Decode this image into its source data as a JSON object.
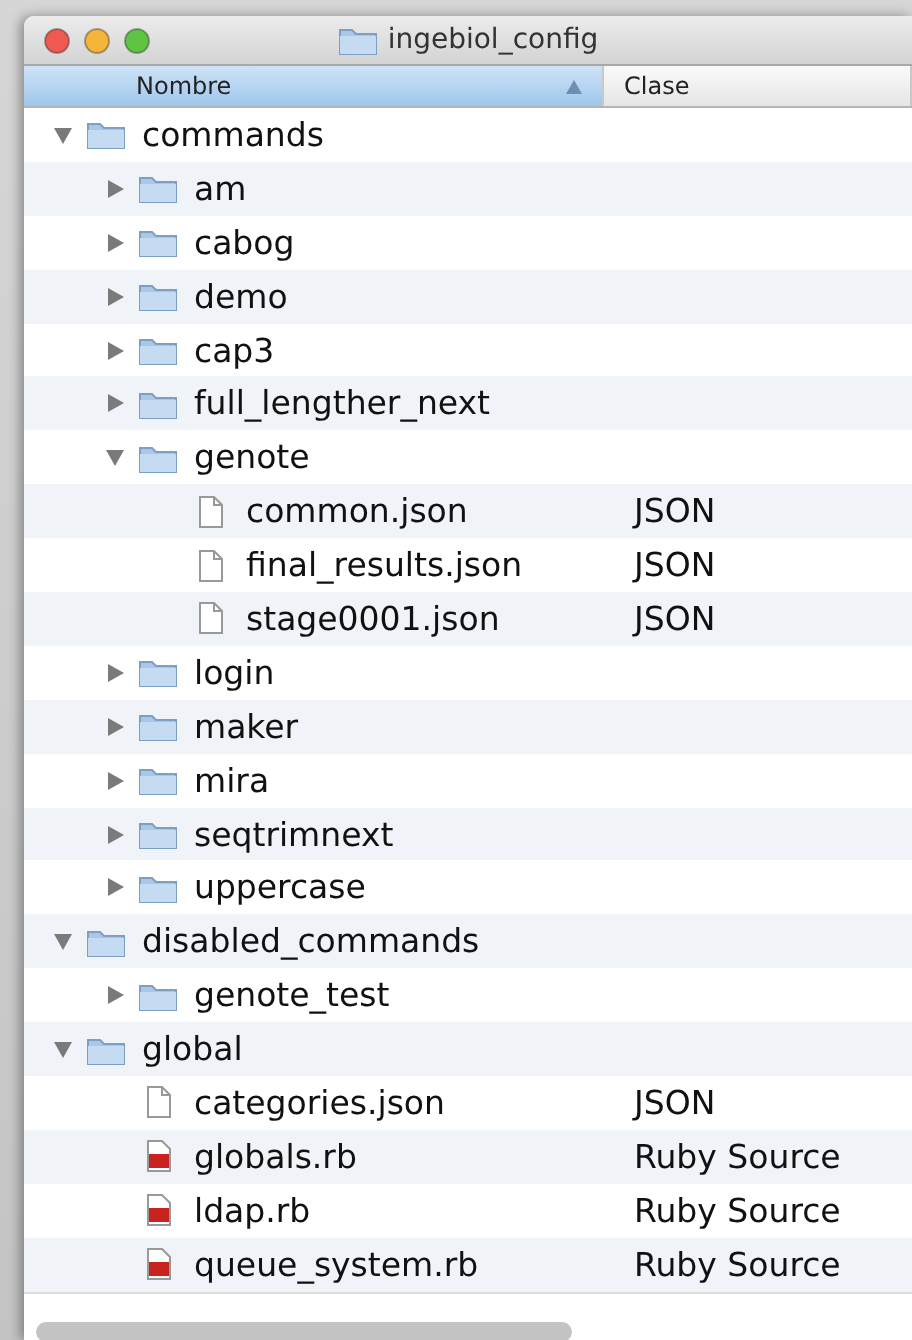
{
  "window": {
    "title": "ingebiol_config"
  },
  "columns": [
    {
      "label": "Nombre",
      "selected": true
    },
    {
      "label": "Clase",
      "selected": false
    }
  ],
  "items": [
    {
      "kind": "folder",
      "name": "commands",
      "expanded": true,
      "children": [
        {
          "kind": "folder",
          "name": "am",
          "expanded": false
        },
        {
          "kind": "folder",
          "name": "cabog",
          "expanded": false
        },
        {
          "kind": "folder",
          "name": "demo",
          "expanded": false
        },
        {
          "kind": "folder",
          "name": "cap3",
          "expanded": false
        },
        {
          "kind": "folder",
          "name": "full_lengther_next",
          "expanded": false
        },
        {
          "kind": "folder",
          "name": "genote",
          "expanded": true,
          "children": [
            {
              "kind": "file",
              "name": "common.json",
              "class": "JSON"
            },
            {
              "kind": "file",
              "name": "final_results.json",
              "class": "JSON"
            },
            {
              "kind": "file",
              "name": "stage0001.json",
              "class": "JSON"
            }
          ]
        },
        {
          "kind": "folder",
          "name": "login",
          "expanded": false
        },
        {
          "kind": "folder",
          "name": "maker",
          "expanded": false
        },
        {
          "kind": "folder",
          "name": "mira",
          "expanded": false
        },
        {
          "kind": "folder",
          "name": "seqtrimnext",
          "expanded": false
        },
        {
          "kind": "folder",
          "name": "uppercase",
          "expanded": false
        }
      ]
    },
    {
      "kind": "folder",
      "name": "disabled_commands",
      "expanded": true,
      "children": [
        {
          "kind": "folder",
          "name": "genote_test",
          "expanded": false
        }
      ]
    },
    {
      "kind": "folder",
      "name": "global",
      "expanded": true,
      "children": [
        {
          "kind": "file",
          "name": "categories.json",
          "class": "JSON"
        },
        {
          "kind": "ruby",
          "name": "globals.rb",
          "class": "Ruby Source"
        },
        {
          "kind": "ruby",
          "name": "ldap.rb",
          "class": "Ruby Source"
        },
        {
          "kind": "ruby",
          "name": "queue_system.rb",
          "class": "Ruby Source"
        }
      ]
    }
  ]
}
